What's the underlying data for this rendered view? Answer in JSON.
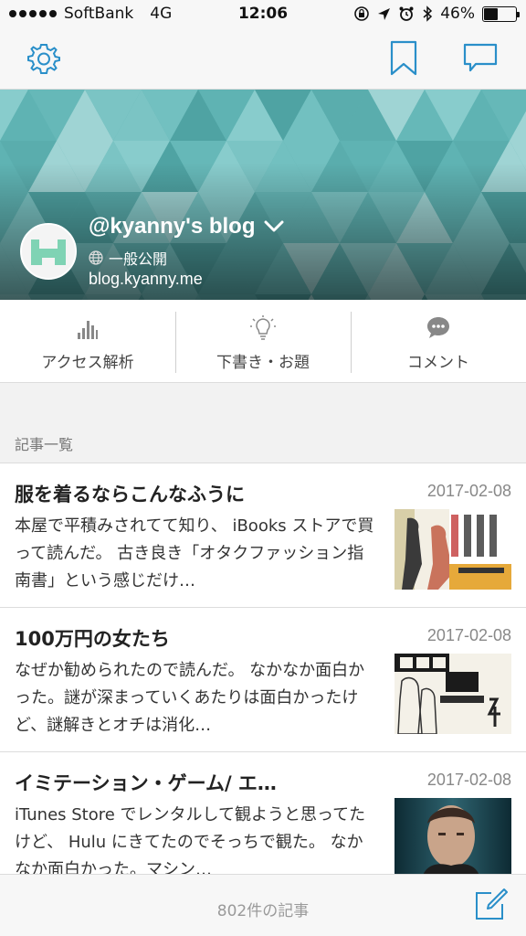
{
  "status_bar": {
    "carrier": "SoftBank",
    "network": "4G",
    "time": "12:06",
    "battery_percent": "46%",
    "battery_level": 0.46
  },
  "nav": {
    "icons": [
      "gear-icon",
      "bookmark-icon",
      "comment-icon"
    ],
    "accent_color": "#2a8fc9"
  },
  "header": {
    "blog_title": "@kyanny's blog",
    "visibility": "一般公開",
    "url": "blog.kyanny.me",
    "pattern_color": "#5fb3b3"
  },
  "tabs": [
    {
      "label": "アクセス解析",
      "icon": "bar-chart-icon"
    },
    {
      "label": "下書き・お題",
      "icon": "lightbulb-icon"
    },
    {
      "label": "コメント",
      "icon": "speech-bubble-icon"
    }
  ],
  "section": {
    "title": "記事一覧"
  },
  "articles": [
    {
      "title": "服を着るならこんなふうに",
      "date": "2017-02-08",
      "excerpt": "本屋で平積みされてて知り、 iBooks ストアで買って読んだ。 古き良き「オタクファッション指南書」という感じだけ…"
    },
    {
      "title": "100万円の女たち",
      "date": "2017-02-08",
      "excerpt": "なぜか勧められたので読んだ。 なかなか面白かった。謎が深まっていくあたりは面白かったけど、謎解きとオチは消化…"
    },
    {
      "title": "イミテーション・ゲーム/ エ…",
      "date": "2017-02-08",
      "excerpt": "iTunes Store でレンタルして観ようと思ってたけど、 Hulu にきてたのでそっちで観た。 なかなか面白かった。マシン…"
    }
  ],
  "toolbar": {
    "article_count": "802件の記事",
    "compose_icon": "compose-icon"
  }
}
